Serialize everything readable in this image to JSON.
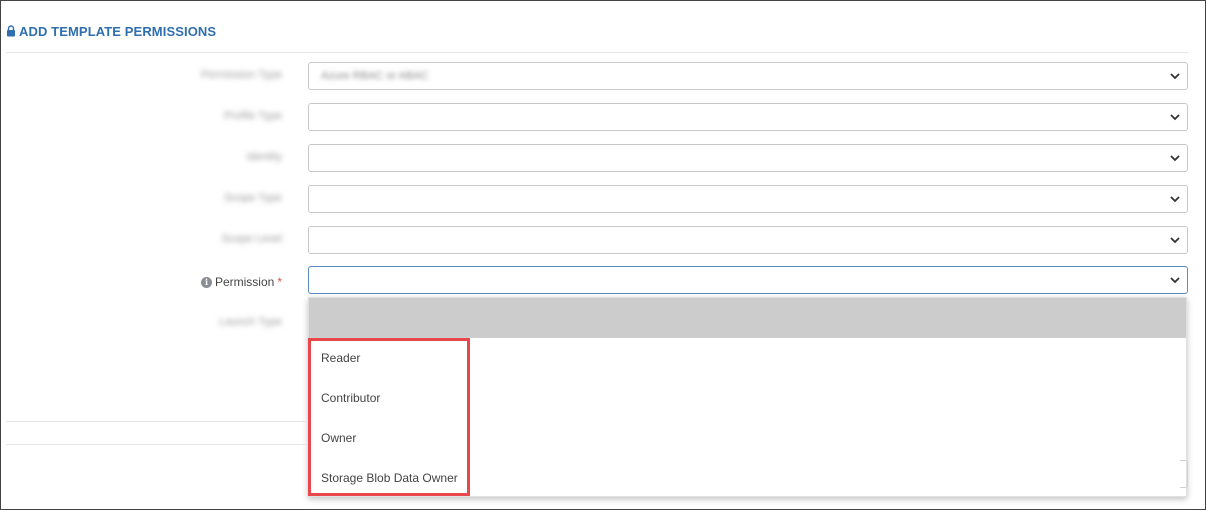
{
  "page": {
    "title": "ADD TEMPLATE PERMISSIONS"
  },
  "form": {
    "fields": [
      {
        "label": "Permission Type",
        "value": "Azure RBAC or ABAC"
      },
      {
        "label": "Profile Type",
        "value": ""
      },
      {
        "label": "Identity",
        "value": ""
      },
      {
        "label": "Scope Type",
        "value": ""
      },
      {
        "label": "Scope Level",
        "value": ""
      }
    ],
    "permission": {
      "label": "Permission",
      "required_mark": "*",
      "value": ""
    },
    "hidden_field": {
      "label": "Launch Type"
    }
  },
  "dropdown": {
    "options": [
      "Reader",
      "Contributor",
      "Owner",
      "Storage Blob Data Owner"
    ]
  },
  "colors": {
    "accent": "#2f6fb0",
    "highlight": "#e8474b",
    "required": "#d9534f"
  },
  "icons": [
    "lock-icon",
    "info-icon",
    "chevron-down-icon"
  ]
}
